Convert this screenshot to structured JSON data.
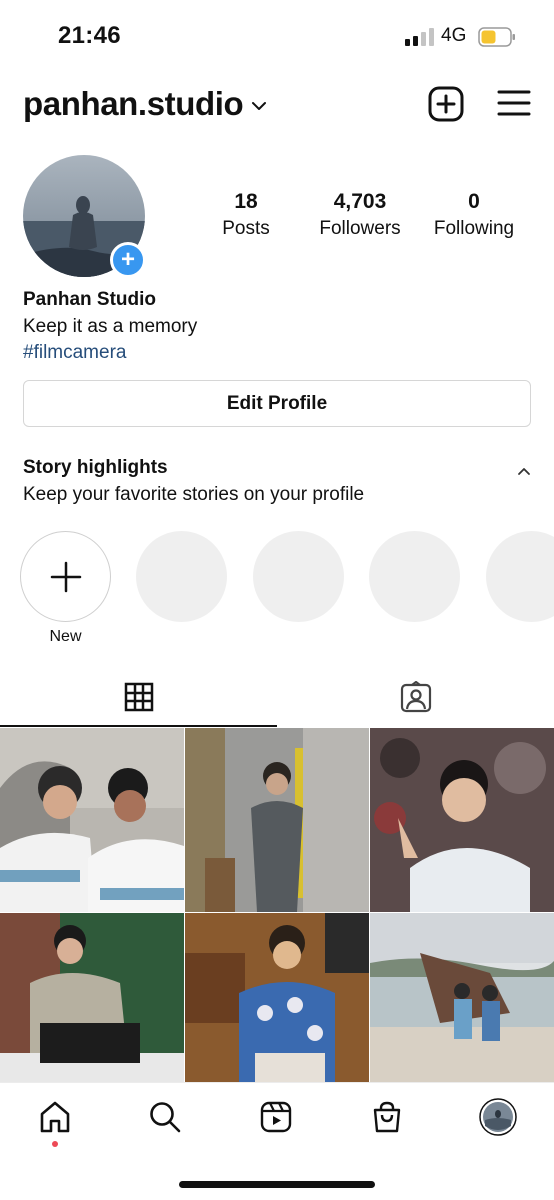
{
  "status_bar": {
    "time": "21:46",
    "network": "4G",
    "signal_icon": "cellular-signal-icon",
    "battery_icon": "battery-low-icon",
    "battery_color": "#f5c430"
  },
  "header": {
    "username": "panhan.studio",
    "switch_account_icon": "chevron-down-icon",
    "new_post_icon": "plus-square-icon",
    "menu_icon": "hamburger-menu-icon"
  },
  "profile": {
    "add_story_symbol": "+",
    "stats": [
      {
        "value": "18",
        "label": "Posts"
      },
      {
        "value": "4,703",
        "label": "Followers"
      },
      {
        "value": "0",
        "label": "Following"
      }
    ],
    "name": "Panhan Studio",
    "bio": "Keep it as a memory",
    "hashtag": "#filmcamera",
    "edit_label": "Edit Profile"
  },
  "highlights": {
    "title": "Story highlights",
    "subtitle": "Keep your favorite stories on your profile",
    "new_label": "New"
  },
  "tabs": [
    {
      "icon": "grid-icon",
      "active": true
    },
    {
      "icon": "tagged-person-icon",
      "active": false
    }
  ],
  "bottom_nav": [
    {
      "icon": "home-icon",
      "active": true
    },
    {
      "icon": "search-icon",
      "active": false
    },
    {
      "icon": "reels-icon",
      "active": false
    },
    {
      "icon": "shop-bag-icon",
      "active": false
    },
    {
      "icon": "profile-avatar-icon",
      "active": false
    }
  ],
  "colors": {
    "accent_blue": "#3897f0",
    "hashtag_blue": "#264d7a",
    "notification_red": "#ed4956"
  }
}
